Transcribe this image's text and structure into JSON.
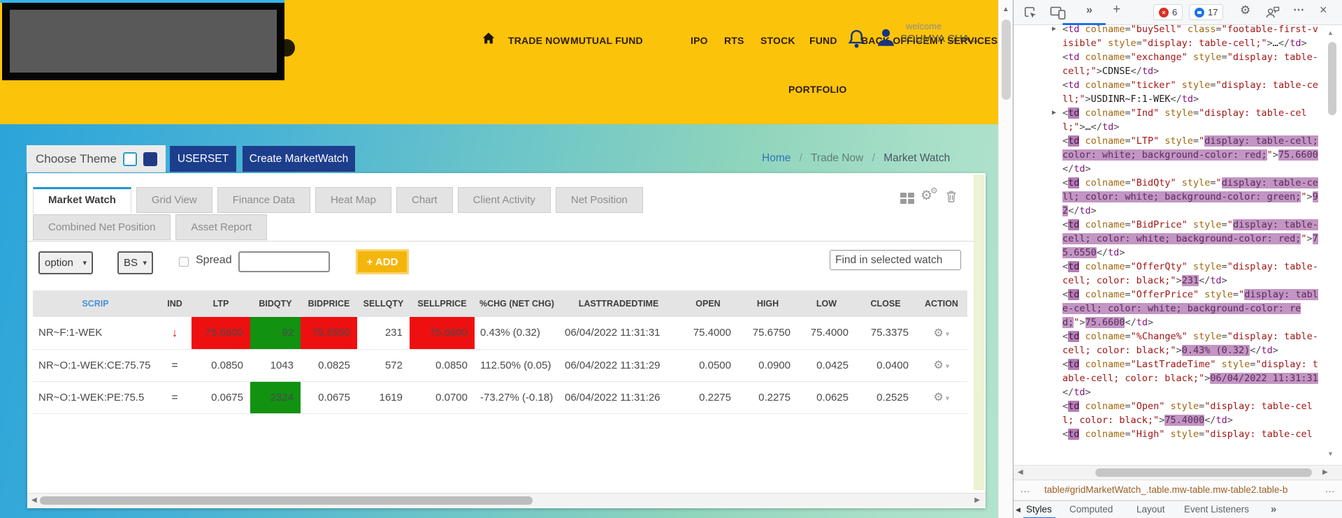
{
  "header": {
    "nav_items": [
      "TRADE NOW",
      "MUTUAL FUND",
      "IPO",
      "RTS",
      "STOCK",
      "FUND",
      "BACK OFFICE",
      "MY SERVICES"
    ],
    "portfolio": "PORTFOLIO",
    "welcome_label": "welcome",
    "username": "SOUMYA CHA..."
  },
  "theme_bar": {
    "label": "Choose Theme"
  },
  "buttons": {
    "userset": "USERSET",
    "create_marketwatch": "Create MarketWatch",
    "add": "+ ADD"
  },
  "breadcrumb": {
    "items": [
      "Home",
      "Trade Now",
      "Market Watch"
    ],
    "separator": "/"
  },
  "tabs": {
    "row1": [
      "Market Watch",
      "Grid View",
      "Finance Data",
      "Heat Map",
      "Chart",
      "Client Activity",
      "Net Position"
    ],
    "row2": [
      "Combined Net Position",
      "Asset Report"
    ],
    "active": "Market Watch"
  },
  "toolbar": {
    "select_option": "option",
    "select_bs": "BS",
    "spread_label": "Spread",
    "find_placeholder": "Find in selected watch"
  },
  "market_table": {
    "columns": [
      {
        "key": "scrip",
        "label": "SCRIP",
        "align": "al"
      },
      {
        "key": "ind",
        "label": "IND",
        "align": "ac"
      },
      {
        "key": "ltp",
        "label": "LTP",
        "align": "ar"
      },
      {
        "key": "bidqty",
        "label": "BIDQTY",
        "align": "ar"
      },
      {
        "key": "bidprice",
        "label": "BIDPRICE",
        "align": "ar"
      },
      {
        "key": "sellqty",
        "label": "SELLQTY",
        "align": "ar"
      },
      {
        "key": "sellprice",
        "label": "SELLPRICE",
        "align": "ar"
      },
      {
        "key": "chg",
        "label": "%CHG (NET CHG)",
        "align": "al"
      },
      {
        "key": "time",
        "label": "LASTTRADEDTIME",
        "align": "al"
      },
      {
        "key": "open",
        "label": "OPEN",
        "align": "ar"
      },
      {
        "key": "high",
        "label": "HIGH",
        "align": "ar"
      },
      {
        "key": "low",
        "label": "LOW",
        "align": "ar"
      },
      {
        "key": "close",
        "label": "CLOSE",
        "align": "ar"
      },
      {
        "key": "action",
        "label": "ACTION",
        "align": "ac"
      }
    ],
    "rows": [
      {
        "cells": [
          {
            "v": "NR~F:1-WEK"
          },
          {
            "v": "↓",
            "ind": "down"
          },
          {
            "v": "75.6600",
            "bg": "red"
          },
          {
            "v": "92",
            "bg": "green"
          },
          {
            "v": "75.6550",
            "bg": "red"
          },
          {
            "v": "231"
          },
          {
            "v": "75.6600",
            "bg": "red"
          },
          {
            "v": "0.43% (0.32)"
          },
          {
            "v": "06/04/2022 11:31:31"
          },
          {
            "v": "75.4000"
          },
          {
            "v": "75.6750"
          },
          {
            "v": "75.4000"
          },
          {
            "v": "75.3375"
          },
          {
            "action": true
          }
        ]
      },
      {
        "cells": [
          {
            "v": "NR~O:1-WEK:CE:75.75"
          },
          {
            "v": "=",
            "ind": "eq"
          },
          {
            "v": "0.0850"
          },
          {
            "v": "1043"
          },
          {
            "v": "0.0825"
          },
          {
            "v": "572"
          },
          {
            "v": "0.0850"
          },
          {
            "v": "112.50% (0.05)"
          },
          {
            "v": "06/04/2022 11:31:29"
          },
          {
            "v": "0.0500"
          },
          {
            "v": "0.0900"
          },
          {
            "v": "0.0425"
          },
          {
            "v": "0.0400"
          },
          {
            "action": true
          }
        ]
      },
      {
        "cells": [
          {
            "v": "NR~O:1-WEK:PE:75.5"
          },
          {
            "v": "=",
            "ind": "eq"
          },
          {
            "v": "0.0675"
          },
          {
            "v": "2324",
            "bg": "green"
          },
          {
            "v": "0.0675"
          },
          {
            "v": "1619"
          },
          {
            "v": "0.0700"
          },
          {
            "v": "-73.27% (-0.18)"
          },
          {
            "v": "06/04/2022 11:31:26"
          },
          {
            "v": "0.2275"
          },
          {
            "v": "0.2275"
          },
          {
            "v": "0.0625"
          },
          {
            "v": "0.2525"
          },
          {
            "action": true
          }
        ]
      }
    ]
  },
  "devtools": {
    "error_count": "6",
    "message_count": "17",
    "status_path": "table#gridMarketWatch_.table.mw-table.mw-table2.table-b",
    "bottom_tabs": [
      "Styles",
      "Computed",
      "Layout",
      "Event Listeners"
    ],
    "code_lines": [
      {
        "arrow": true,
        "seg": [
          [
            "p",
            "<"
          ],
          [
            "t",
            "td"
          ],
          [
            "p",
            " "
          ],
          [
            "a",
            "colname"
          ],
          [
            "p",
            "="
          ],
          [
            "v",
            "\"buySell\""
          ],
          [
            "p",
            " "
          ],
          [
            "a",
            "class"
          ],
          [
            "p",
            "="
          ],
          [
            "v",
            "\"footable-first-visible\""
          ],
          [
            "p",
            " "
          ],
          [
            "a",
            "style"
          ],
          [
            "p",
            "="
          ],
          [
            "v",
            "\"display: table-cell;\""
          ],
          [
            "p",
            ">"
          ],
          [
            "x",
            "…"
          ],
          [
            "p",
            "</"
          ],
          [
            "t",
            "td"
          ],
          [
            "p",
            ">"
          ]
        ]
      },
      {
        "arrow": false,
        "seg": [
          [
            "p",
            "<"
          ],
          [
            "t",
            "td"
          ],
          [
            "p",
            " "
          ],
          [
            "a",
            "colname"
          ],
          [
            "p",
            "="
          ],
          [
            "v",
            "\"exchange\""
          ],
          [
            "p",
            " "
          ],
          [
            "a",
            "style"
          ],
          [
            "p",
            "="
          ],
          [
            "v",
            "\"display: table-cell;\""
          ],
          [
            "p",
            ">"
          ],
          [
            "x",
            "CDNSE"
          ],
          [
            "p",
            "</"
          ],
          [
            "t",
            "td"
          ],
          [
            "p",
            ">"
          ]
        ]
      },
      {
        "arrow": false,
        "seg": [
          [
            "p",
            "<"
          ],
          [
            "t",
            "td"
          ],
          [
            "p",
            " "
          ],
          [
            "a",
            "colname"
          ],
          [
            "p",
            "="
          ],
          [
            "v",
            "\"ticker\""
          ],
          [
            "p",
            " "
          ],
          [
            "a",
            "style"
          ],
          [
            "p",
            "="
          ],
          [
            "v",
            "\"display: table-cell;\""
          ],
          [
            "p",
            ">"
          ],
          [
            "x",
            "USDINR~F:1-WEK"
          ],
          [
            "p",
            "</"
          ],
          [
            "t",
            "td"
          ],
          [
            "p",
            ">"
          ]
        ]
      },
      {
        "arrow": true,
        "seg": [
          [
            "p",
            "<"
          ],
          [
            "th",
            "td"
          ],
          [
            "p",
            " "
          ],
          [
            "a",
            "colname"
          ],
          [
            "p",
            "="
          ],
          [
            "v",
            "\"Ind\""
          ],
          [
            "p",
            " "
          ],
          [
            "a",
            "style"
          ],
          [
            "p",
            "="
          ],
          [
            "v",
            "\"display: table-cell;\""
          ],
          [
            "p",
            ">"
          ],
          [
            "x",
            "…"
          ],
          [
            "p",
            "</"
          ],
          [
            "t",
            "td"
          ],
          [
            "p",
            ">"
          ]
        ]
      },
      {
        "arrow": false,
        "seg": [
          [
            "p",
            "<"
          ],
          [
            "th",
            "td"
          ],
          [
            "p",
            " "
          ],
          [
            "a",
            "colname"
          ],
          [
            "p",
            "="
          ],
          [
            "v",
            "\"LTP\""
          ],
          [
            "p",
            " "
          ],
          [
            "a",
            "style"
          ],
          [
            "p",
            "="
          ],
          [
            "v",
            "\""
          ],
          [
            "vh",
            "display: table-cell; color: white; background-color: red;"
          ],
          [
            "v",
            "\""
          ],
          [
            "p",
            ">"
          ],
          [
            "xh",
            "75.6600"
          ],
          [
            "p",
            "</"
          ],
          [
            "t",
            "td"
          ],
          [
            "p",
            ">"
          ]
        ]
      },
      {
        "arrow": false,
        "seg": [
          [
            "p",
            "<"
          ],
          [
            "th",
            "td"
          ],
          [
            "p",
            " "
          ],
          [
            "a",
            "colname"
          ],
          [
            "p",
            "="
          ],
          [
            "v",
            "\"BidQty\""
          ],
          [
            "p",
            " "
          ],
          [
            "a",
            "style"
          ],
          [
            "p",
            "="
          ],
          [
            "v",
            "\""
          ],
          [
            "vh",
            "display: table-cell; color: white; background-color: green;"
          ],
          [
            "v",
            "\""
          ],
          [
            "p",
            ">"
          ],
          [
            "xh",
            "92"
          ],
          [
            "p",
            "</"
          ],
          [
            "t",
            "td"
          ],
          [
            "p",
            ">"
          ]
        ]
      },
      {
        "arrow": false,
        "seg": [
          [
            "p",
            "<"
          ],
          [
            "th",
            "td"
          ],
          [
            "p",
            " "
          ],
          [
            "a",
            "colname"
          ],
          [
            "p",
            "="
          ],
          [
            "v",
            "\"BidPrice\""
          ],
          [
            "p",
            " "
          ],
          [
            "a",
            "style"
          ],
          [
            "p",
            "="
          ],
          [
            "v",
            "\""
          ],
          [
            "vh",
            "display: table-cell; color: white; background-color: red;"
          ],
          [
            "v",
            "\""
          ],
          [
            "p",
            ">"
          ],
          [
            "xh",
            "75.6550"
          ],
          [
            "p",
            "</"
          ],
          [
            "t",
            "td"
          ],
          [
            "p",
            ">"
          ]
        ]
      },
      {
        "arrow": false,
        "seg": [
          [
            "p",
            "<"
          ],
          [
            "th",
            "td"
          ],
          [
            "p",
            " "
          ],
          [
            "a",
            "colname"
          ],
          [
            "p",
            "="
          ],
          [
            "v",
            "\"OfferQty\""
          ],
          [
            "p",
            " "
          ],
          [
            "a",
            "style"
          ],
          [
            "p",
            "="
          ],
          [
            "v",
            "\"display: table-cell; color: black;\""
          ],
          [
            "p",
            ">"
          ],
          [
            "xh",
            "231"
          ],
          [
            "p",
            "</"
          ],
          [
            "t",
            "td"
          ],
          [
            "p",
            ">"
          ]
        ]
      },
      {
        "arrow": false,
        "seg": [
          [
            "p",
            "<"
          ],
          [
            "th",
            "td"
          ],
          [
            "p",
            " "
          ],
          [
            "a",
            "colname"
          ],
          [
            "p",
            "="
          ],
          [
            "v",
            "\"OfferPrice\""
          ],
          [
            "p",
            " "
          ],
          [
            "a",
            "style"
          ],
          [
            "p",
            "="
          ],
          [
            "v",
            "\""
          ],
          [
            "vh",
            "display: table-cell; color: white; background-color: red;"
          ],
          [
            "v",
            "\""
          ],
          [
            "p",
            ">"
          ],
          [
            "xh",
            "75.6600"
          ],
          [
            "p",
            "</"
          ],
          [
            "t",
            "td"
          ],
          [
            "p",
            ">"
          ]
        ]
      },
      {
        "arrow": false,
        "seg": [
          [
            "p",
            "<"
          ],
          [
            "th",
            "td"
          ],
          [
            "p",
            " "
          ],
          [
            "a",
            "colname"
          ],
          [
            "p",
            "="
          ],
          [
            "v",
            "\"%Change%\""
          ],
          [
            "p",
            " "
          ],
          [
            "a",
            "style"
          ],
          [
            "p",
            "="
          ],
          [
            "v",
            "\"display: table-cell; color: black;\""
          ],
          [
            "p",
            ">"
          ],
          [
            "xh",
            "0.43% (0.32)"
          ],
          [
            "p",
            "</"
          ],
          [
            "t",
            "td"
          ],
          [
            "p",
            ">"
          ]
        ]
      },
      {
        "arrow": false,
        "seg": [
          [
            "p",
            "<"
          ],
          [
            "th",
            "td"
          ],
          [
            "p",
            " "
          ],
          [
            "a",
            "colname"
          ],
          [
            "p",
            "="
          ],
          [
            "v",
            "\"LastTradeTime\""
          ],
          [
            "p",
            " "
          ],
          [
            "a",
            "style"
          ],
          [
            "p",
            "="
          ],
          [
            "v",
            "\"display: table-cell; color: black;\""
          ],
          [
            "p",
            ">"
          ],
          [
            "xh",
            "06/04/2022 11:31:31"
          ],
          [
            "p",
            "</"
          ],
          [
            "t",
            "td"
          ],
          [
            "p",
            ">"
          ]
        ]
      },
      {
        "arrow": false,
        "seg": [
          [
            "p",
            "<"
          ],
          [
            "th",
            "td"
          ],
          [
            "p",
            " "
          ],
          [
            "a",
            "colname"
          ],
          [
            "p",
            "="
          ],
          [
            "v",
            "\"Open\""
          ],
          [
            "p",
            " "
          ],
          [
            "a",
            "style"
          ],
          [
            "p",
            "="
          ],
          [
            "v",
            "\"display: table-cell; color: black;\""
          ],
          [
            "p",
            ">"
          ],
          [
            "xh",
            "75.4000"
          ],
          [
            "p",
            "</"
          ],
          [
            "t",
            "td"
          ],
          [
            "p",
            ">"
          ]
        ]
      },
      {
        "arrow": false,
        "seg": [
          [
            "p",
            "<"
          ],
          [
            "th",
            "td"
          ],
          [
            "p",
            " "
          ],
          [
            "a",
            "colname"
          ],
          [
            "p",
            "="
          ],
          [
            "v",
            "\"High\""
          ],
          [
            "p",
            " "
          ],
          [
            "a",
            "style"
          ],
          [
            "p",
            "="
          ],
          [
            "v",
            "\"display: table-cel"
          ]
        ]
      }
    ]
  },
  "icons": {
    "tree_expand": "▶",
    "gear": "⚙",
    "caret_down": "▾",
    "select_chevron": "▾",
    "scroll_up": "▲",
    "scroll_down": "▼",
    "scroll_left": "◀",
    "scroll_right": "▶",
    "more_chevrons": "»",
    "plus": "+",
    "dots": "⋯",
    "close": "×",
    "error_x": "×",
    "ellipsis": "..."
  },
  "colors": {
    "header_yellow": "#fcc30b",
    "navy": "#1d3e8c",
    "cell_red": "#ee1010",
    "cell_green": "#119211",
    "tab_accent_blue": "#1b98d5",
    "devtools_accent": "#1f6feb",
    "dom_highlight": "#c295c2"
  }
}
